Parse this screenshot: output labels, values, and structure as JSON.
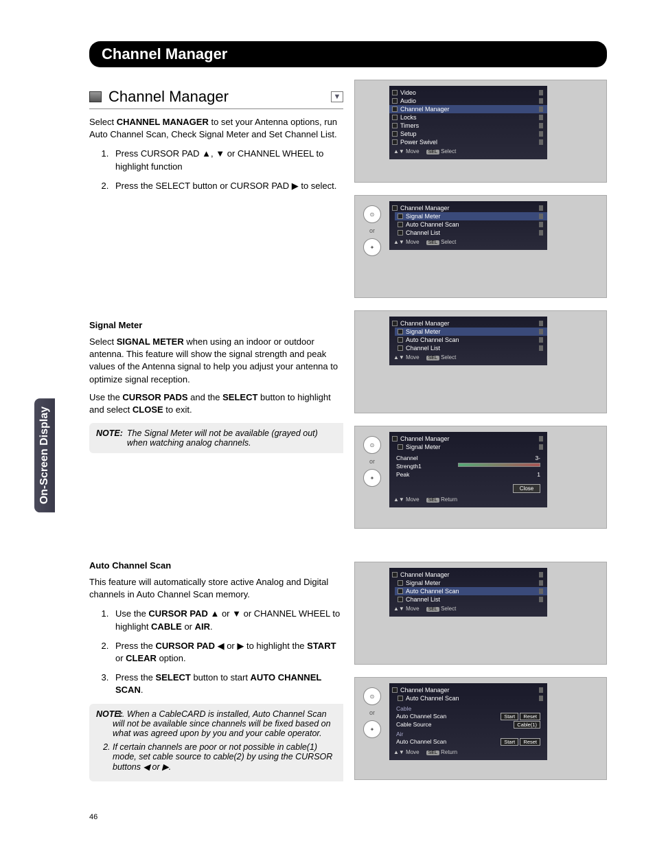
{
  "side_tab": "On-Screen Display",
  "title": "Channel Manager",
  "section_head": "Channel Manager",
  "intro": {
    "pre": "Select ",
    "bold": "CHANNEL MANAGER",
    "post": " to set your Antenna options, run Auto Channel Scan, Check Signal Meter and Set Channel List."
  },
  "intro_steps": [
    "Press CURSOR PAD ▲, ▼ or CHANNEL WHEEL to highlight function",
    "Press the SELECT button or CURSOR PAD ▶ to select."
  ],
  "signal": {
    "heading": "Signal Meter",
    "p1_pre": "Select ",
    "p1_bold": "SIGNAL METER",
    "p1_post": " when using an indoor or outdoor antenna. This feature will show the signal strength and peak values of the Antenna signal to help you adjust your antenna to optimize signal reception.",
    "p2": "Use the CURSOR PADS and the SELECT button to highlight and select CLOSE to exit.",
    "note_label": "NOTE:",
    "note": "The Signal Meter will not be available (grayed out) when watching analog channels."
  },
  "auto": {
    "heading": "Auto Channel Scan",
    "p1": "This feature will automatically store active Analog and Digital channels in Auto Channel Scan memory.",
    "steps": [
      "Use the CURSOR PAD ▲ or ▼ or CHANNEL WHEEL to highlight CABLE or AIR.",
      "Press the CURSOR PAD ◀ or ▶ to highlight the START or CLEAR option.",
      "Press the SELECT button to start AUTO CHANNEL SCAN."
    ],
    "note_label": "NOTE:",
    "notes": [
      "When a CableCARD is installed, Auto Channel Scan will not be available since channels will be fixed based on what was agreed upon by you and your cable operator.",
      "If certain channels are poor or not possible in cable(1) mode, set cable source to cable(2) by using the CURSOR buttons ◀ or ▶."
    ]
  },
  "shots": {
    "or": "or",
    "foot_move": "Move",
    "foot_sel": "SEL",
    "foot_select": "Select",
    "foot_return": "Return",
    "main_menu": [
      "Video",
      "Audio",
      "Channel Manager",
      "Locks",
      "Timers",
      "Setup",
      "Power Swivel"
    ],
    "cm_menu": [
      "Channel Manager",
      "Signal Meter",
      "Auto Channel Scan",
      "Channel List"
    ],
    "meter": {
      "head1": "Channel Manager",
      "head2": "Signal Meter",
      "rows": [
        [
          "Channel",
          "3-"
        ],
        [
          "Strength",
          "1"
        ],
        [
          "Peak",
          "1"
        ]
      ],
      "close": "Close"
    },
    "scan": {
      "head1": "Channel Manager",
      "head2": "Auto Channel Scan",
      "cable": "Cable",
      "air": "Air",
      "acs": "Auto Channel Scan",
      "src": "Cable Source",
      "start": "Start",
      "reset": "Reset",
      "cable1": "Cable(1)"
    }
  },
  "page_number": "46"
}
